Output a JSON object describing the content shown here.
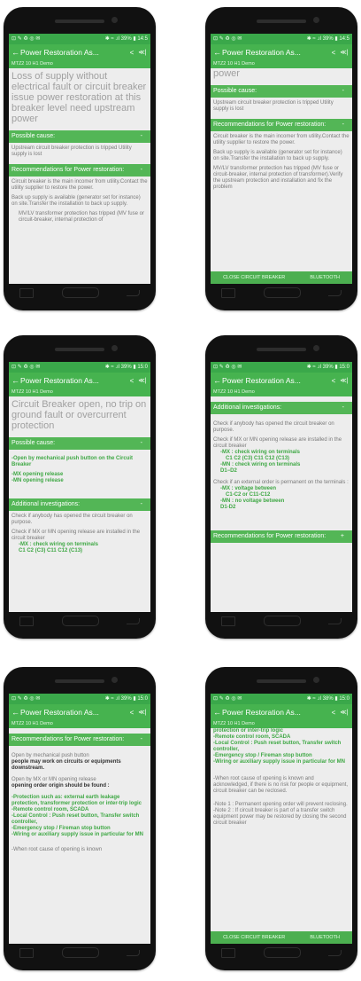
{
  "status": {
    "left": "⊡ ✎ ♻ ◎ ✉",
    "right": "✱ ≈ .ıl 39% ▮ 14:5"
  },
  "status_b": {
    "right": "✱ ≈ .ıl 39% ▮ 15:0"
  },
  "status_c": {
    "right": "✱ ≈ .ıl 38% ▮ 15:0"
  },
  "app": {
    "title": "Power Restoration As...",
    "subtitle": "MTZ2 10 H1 Demo"
  },
  "bottom": {
    "close": "CLOSE CIRCUIT BREAKER",
    "bluetooth": "BLUETOOTH"
  },
  "s1": {
    "title": "Loss of supply without electrical fault or circuit breaker issue power restoration at this breaker level need upstream power",
    "cause_head": "Possible cause:",
    "cause": "Upstream circuit breaker protection is tripped Utility supply is lost",
    "rec_head": "Recommendations for Power restoration:",
    "rec": "Circuit breaker is the main incomer from utility.Contact the utility supplier to restore the power.",
    "rec2": "Back up supply is available (generator set for instance) on site.Transfer the installation to back up supply.",
    "rec3": "MV/LV transformer protection has tripped (MV fuse or circuit-breaker, internal protection of"
  },
  "s2": {
    "title": "power",
    "cause_head": "Possible cause:",
    "cause": "Upstream circuit breaker protection is tripped Utility supply is lost",
    "rec_head": "Recommendations for Power restoration:",
    "rec": "Circuit breaker is the main incomer from utility.Contact the utility supplier to restore the power.",
    "rec2": "Back up supply is available (generator set for instance) on site.Transfer the installation to back up supply.",
    "rec3": "MV/LV transformer protection has tripped (MV fuse or circuit-breaker, internal protection of transformer).Verify the upstream protection and installation and fix the problem"
  },
  "s3": {
    "title": "Circuit Breaker open, no trip on ground fault or overcurrent protection",
    "cause_head": "Possible cause:",
    "c1": "-Open by mechanical push button on the Circuit Breaker",
    "c2": "-MX opening release",
    "c3": "-MN opening release",
    "inv_head": "Additional investigations:",
    "i1": "Check if anybody has opened the circuit breaker on purpose.",
    "i2": "Check if MX or MN opening release are installed in the circuit breaker",
    "i3": "-MX : check wiring on terminals",
    "i4": "C1 C2 (C3) C11 C12 (C13)"
  },
  "s4": {
    "inv_head": "Additional investigations:",
    "i1": "Check if anybody has opened the circuit breaker on purpose.",
    "i2": "Check if MX or MN opening release are installed in the circuit breaker",
    "i3": "-MX : check wiring on terminals",
    "i4": "C1 C2 (C3) C11 C12 (C13)",
    "i5": "-MN : check wiring on terminals",
    "i6": "D1−D2",
    "i7": "Check if an external order is permanent on the terminals :",
    "i8": "-MX : voltage between",
    "i9": "C1-C2 or C11-C12",
    "i10": "-MN : no voltage between",
    "i11": "D1-D2",
    "rec_head": "Recommendations for Power restoration:"
  },
  "s5": {
    "rec_head": "Recommendations for Power restoration:",
    "p1": "Open by mechanical push button",
    "p1b": "people may work on circuits or equipments downstream.",
    "p2": "Open by MX or MN opening release",
    "p2b": "opening order origin should be found :",
    "g1": "-Protection such as: external earth leakage protection, transformer protection or inter-trip logic",
    "g2": "-Remote control room, SCADA",
    "g3": "-Local Control : Push reset button, Transfer switch controller,",
    "g4": "-Emergency stop / Fireman stop button",
    "g5": "-Wiring or auxiliary supply issue in particular for MN",
    "p3": "-When root cause of opening is known"
  },
  "s6": {
    "g0": "protection or inter-trip logic",
    "g2": "-Remote control room, SCADA",
    "g3": "-Local Control : Push reset button, Transfer switch controller,",
    "g4": "-Emergency stop / Fireman stop button",
    "g5": "-Wiring or auxiliary supply issue in particular for MN",
    "p3": "-When root cause of opening is known and acknowledged, if there is no risk for people or equipment, circuit breaker can be reclosed.",
    "n1": "-Note 1 : Permanent opening order will prevent reclosing.",
    "n2": "-Note 2 : If circuit breaker is part of a transfer switch equipment power may be restored by closing the second circuit breaker"
  },
  "icons": {
    "back": "←",
    "share": "<",
    "bt": "≪|"
  },
  "signs": {
    "minus": "-",
    "plus": "+"
  }
}
